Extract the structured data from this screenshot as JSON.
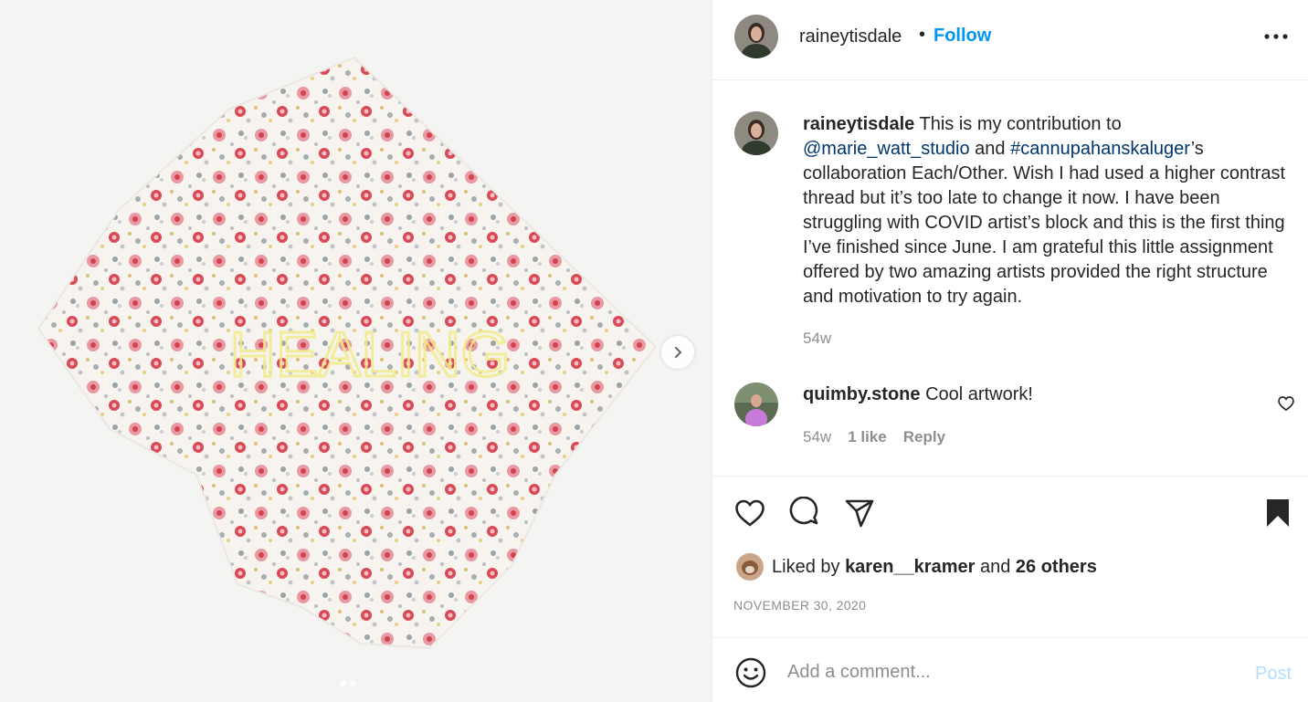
{
  "post": {
    "author": "raineytisdale",
    "separator": "•",
    "follow_label": "Follow",
    "more_icon": "more-options-icon",
    "photo_text": "HEALING",
    "caption": {
      "username": "raineytisdale",
      "text_1": "This is my contribution to",
      "mention": "@marie_watt_studio",
      "text_2": "and",
      "hashtag": "#cannupahanskaluger",
      "text_3": "’s collaboration Each/Other. Wish I had used a higher contrast thread but it’s too late to change it now. I have been struggling with COVID artist’s block and this is the first thing I’ve finished since June. I am grateful this little assignment offered by two amazing artists provided the right structure and motivation to try again.",
      "time": "54w"
    },
    "comment": {
      "username": "quimby.stone",
      "text": "Cool artwork!",
      "time": "54w",
      "likes": "1 like",
      "reply_label": "Reply"
    },
    "likes": {
      "prefix": "Liked by",
      "user": "karen__kramer",
      "middle": "and",
      "others": "26 others"
    },
    "date": "NOVEMBER 30, 2020",
    "add_comment": {
      "placeholder": "Add a comment...",
      "post_label": "Post"
    },
    "carousel": {
      "total": 2,
      "current": 1
    },
    "colors": {
      "follow": "#0095f6",
      "link": "#00376b",
      "muted": "#8e8e8e",
      "post_disabled": "#b2dffc"
    }
  }
}
